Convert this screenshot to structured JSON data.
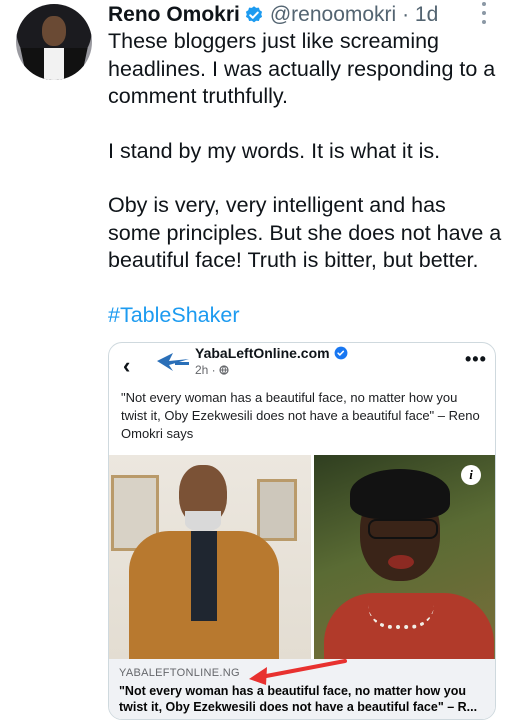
{
  "tweet": {
    "author_name": "Reno Omokri",
    "handle": "@renoomokri",
    "separator": "·",
    "time": "1d",
    "paragraphs": [
      "These bloggers just like screaming headlines. I was actually responding to a comment truthfully.",
      "I stand by my words. It is what it is.",
      "Oby is very, very intelligent and has some principles. But she does not have a beautiful face! Truth is bitter, but better."
    ],
    "hashtag": "#TableShaker"
  },
  "embedded_post": {
    "back_glyph": "‹",
    "page_name": "YabaLeftOnline.com",
    "meta": "2h · ",
    "headline": "\"Not every woman has a beautiful face, no matter how you twist it, Oby Ezekwesili does not have a beautiful face\" – Reno Omokri says",
    "info_glyph": "i",
    "link_domain": "YABALEFTONLINE.NG",
    "link_title": "\"Not every woman has a beautiful face, no matter how you twist it, Oby Ezekwesili does not have a beautiful face\" – R..."
  },
  "colors": {
    "accent": "#1d9bf0",
    "handle_gray": "#536471",
    "annotation_arrow": "#e8312f"
  },
  "icons": [
    "verified-badge-icon",
    "more-options-icon",
    "back-chevron-icon",
    "site-logo-icon",
    "globe-icon",
    "facebook-more-icon",
    "info-icon",
    "red-arrow-annotation"
  ]
}
